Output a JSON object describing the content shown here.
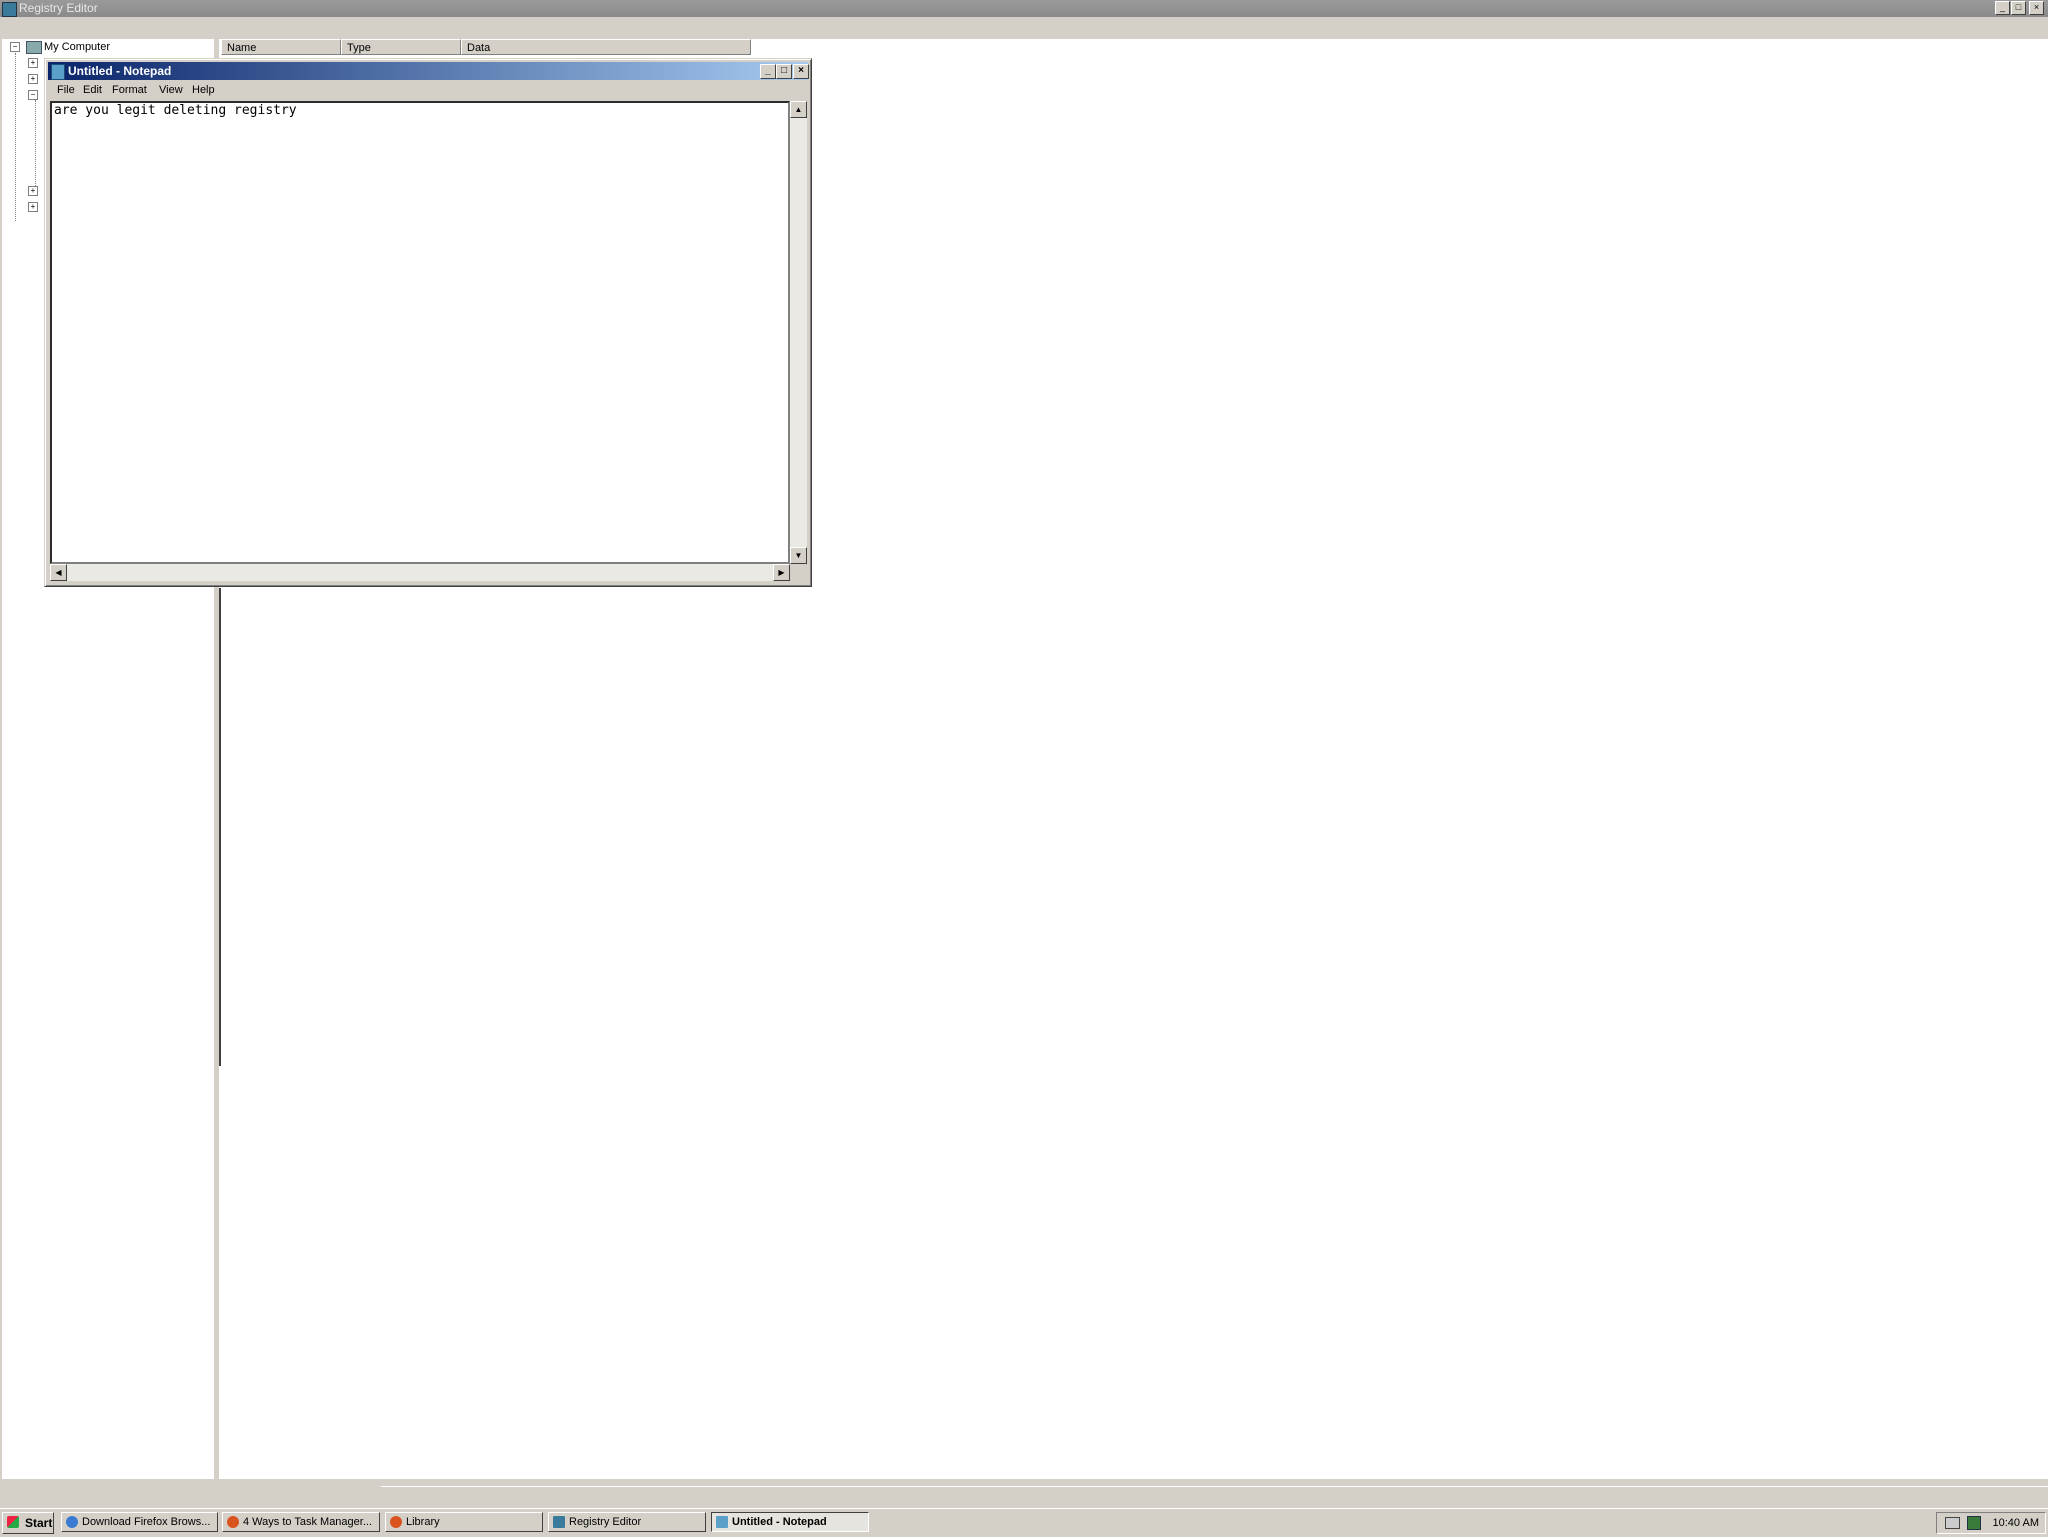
{
  "registry_editor": {
    "title": "Registry Editor",
    "tree": {
      "root": "My Computer"
    },
    "columns": [
      "Name",
      "Type",
      "Data"
    ]
  },
  "notepad": {
    "title": "Untitled - Notepad",
    "menu": [
      "File",
      "Edit",
      "Format",
      "View",
      "Help"
    ],
    "content": "are you legit deleting registry"
  },
  "taskbar": {
    "start_label": "Start",
    "buttons": [
      {
        "label": "Download Firefox Brows...",
        "icon": "ie-icon",
        "color": "#3b7ad1",
        "active": false
      },
      {
        "label": "4 Ways to Task Manager...",
        "icon": "firefox-icon",
        "color": "#d9531e",
        "active": false
      },
      {
        "label": "Library",
        "icon": "firefox-icon",
        "color": "#d9531e",
        "active": false
      },
      {
        "label": "Registry Editor",
        "icon": "regedit-icon",
        "color": "#3a7a9a",
        "active": false
      },
      {
        "label": "Untitled - Notepad",
        "icon": "notepad-icon",
        "color": "#5aa0c8",
        "active": true
      }
    ],
    "clock": "10:40 AM"
  }
}
